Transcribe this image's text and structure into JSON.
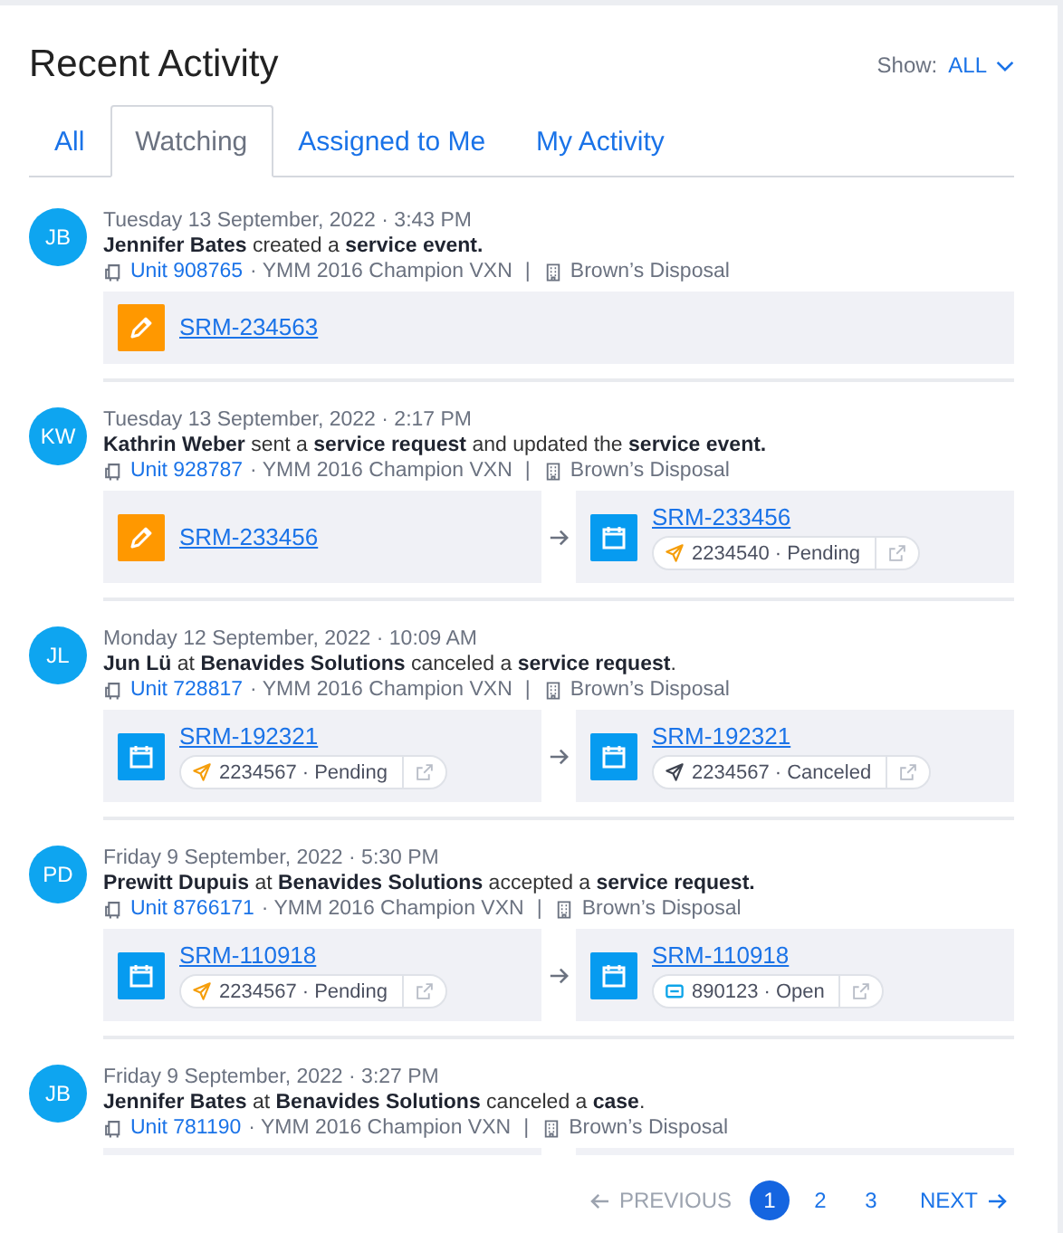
{
  "title": "Recent Activity",
  "show": {
    "label": "Show:",
    "value": "ALL"
  },
  "tabs": [
    {
      "label": "All",
      "selected": false
    },
    {
      "label": "Watching",
      "selected": true
    },
    {
      "label": "Assigned to Me",
      "selected": false
    },
    {
      "label": "My Activity",
      "selected": false
    }
  ],
  "entries": [
    {
      "initials": "JB",
      "time": "Tuesday 13 September, 2022 · 3:43 PM",
      "text": "**Jennifer Bates** created a **service event.**",
      "unit": "Unit 908765",
      "vehicle": "· YMM 2016 Champion VXN",
      "separator": "|",
      "company": "Brown’s Disposal",
      "cards": [
        {
          "kind": "event",
          "link": "SRM-234563"
        }
      ]
    },
    {
      "initials": "KW",
      "time": "Tuesday 13 September, 2022 · 2:17 PM",
      "text": "**Kathrin Weber** sent a **service request** and updated the **service event.**",
      "unit": "Unit 928787",
      "vehicle": "· YMM 2016 Champion VXN",
      "separator": "|",
      "company": "Brown’s Disposal",
      "cards": [
        {
          "kind": "event",
          "link": "SRM-233456"
        },
        {
          "kind": "request",
          "link": "SRM-233456",
          "status": {
            "kind": "sent",
            "color": "#f59e0b",
            "text": "2234540 · Pending"
          }
        }
      ]
    },
    {
      "initials": "JL",
      "time": "Monday 12 September, 2022 · 10:09 AM",
      "text": "**Jun Lü** at **Benavides Solutions** canceled a **service request**.",
      "unit": "Unit 728817",
      "vehicle": "· YMM 2016 Champion VXN",
      "separator": "|",
      "company": "Brown’s Disposal",
      "cards": [
        {
          "kind": "request",
          "link": "SRM-192321",
          "status": {
            "kind": "sent",
            "color": "#f59e0b",
            "text": "2234567 · Pending"
          }
        },
        {
          "kind": "request",
          "link": "SRM-192321",
          "status": {
            "kind": "sent",
            "color": "#3f4450",
            "text": "2234567 · Canceled"
          }
        }
      ]
    },
    {
      "initials": "PD",
      "time": "Friday 9 September, 2022 · 5:30 PM",
      "text": "**Prewitt Dupuis** at **Benavides Solutions** accepted a **service request.**",
      "unit": "Unit 8766171",
      "vehicle": "· YMM 2016 Champion VXN",
      "separator": "|",
      "company": "Brown’s Disposal",
      "cards": [
        {
          "kind": "request",
          "link": "SRM-110918",
          "status": {
            "kind": "sent",
            "color": "#f59e0b",
            "text": "2234567 · Pending"
          }
        },
        {
          "kind": "request",
          "link": "SRM-110918",
          "status": {
            "kind": "ticket",
            "color": "#0ea5e9",
            "text": "890123 · Open"
          }
        }
      ]
    },
    {
      "initials": "JB",
      "time": "Friday 9 September, 2022 · 3:27 PM",
      "text": "**Jennifer Bates** at **Benavides Solutions** canceled a **case**.",
      "unit": "Unit 781190",
      "vehicle": "· YMM 2016 Champion VXN",
      "separator": "|",
      "company": "Brown’s Disposal",
      "cards": [
        {
          "kind": "cut"
        },
        {
          "kind": "cut"
        }
      ]
    }
  ],
  "pagination": {
    "previous": "PREVIOUS",
    "next": "NEXT",
    "pages": [
      {
        "label": "1",
        "selected": true
      },
      {
        "label": "2",
        "selected": false
      },
      {
        "label": "3",
        "selected": false
      }
    ]
  }
}
